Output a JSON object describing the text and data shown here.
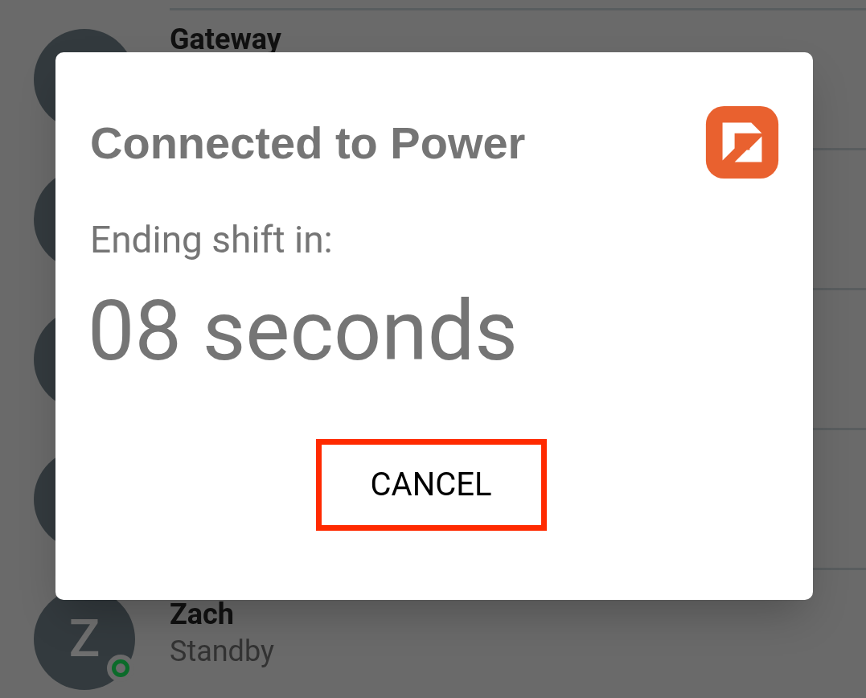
{
  "contacts": [
    {
      "kind": "contact",
      "name": "Gateway"
    },
    {
      "kind": "avatar"
    },
    {
      "kind": "avatar"
    },
    {
      "kind": "avatar"
    },
    {
      "kind": "contact",
      "initial": "Z",
      "name": "Zach",
      "status": "Standby",
      "color": "#0b6b2a"
    }
  ],
  "dialog": {
    "title": "Connected to Power",
    "message": "Ending shift in:",
    "countdown": "08 seconds",
    "buttons": [
      "CANCEL"
    ]
  }
}
